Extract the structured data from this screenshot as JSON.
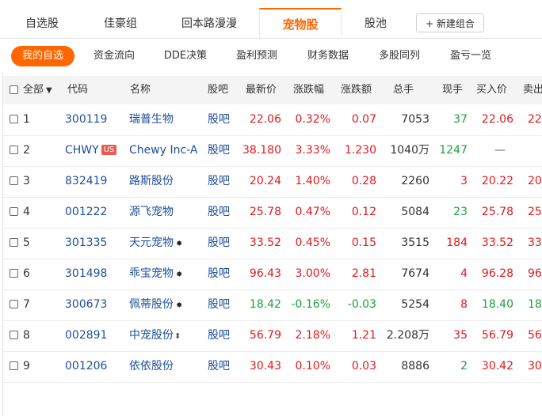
{
  "tabs": [
    {
      "label": "自选股"
    },
    {
      "label": "佳豪组"
    },
    {
      "label": "回本路漫漫"
    },
    {
      "label": "宠物股"
    },
    {
      "label": "股池"
    }
  ],
  "new_group_label": "+ 新建组合",
  "subnav": [
    {
      "label": "我的自选"
    },
    {
      "label": "资金流向"
    },
    {
      "label": "DDE决策"
    },
    {
      "label": "盈利预测"
    },
    {
      "label": "财务数据"
    },
    {
      "label": "多股同列"
    },
    {
      "label": "盈亏一览"
    }
  ],
  "table": {
    "headers": {
      "all": "全部",
      "code": "代码",
      "name": "名称",
      "bar": "股吧",
      "price": "最新价",
      "pct": "涨跌幅",
      "chg": "涨跌额",
      "vol": "总手",
      "cur": "现手",
      "bid": "买入价",
      "ask": "卖出"
    },
    "rows": [
      {
        "idx": "1",
        "code": "300119",
        "name": "瑞普生物",
        "badge": "",
        "mark": "",
        "bar": "股吧",
        "price": "22.06",
        "pct": "0.32%",
        "chg": "0.07",
        "vol": "7053",
        "cur": "37",
        "bid": "22.06",
        "ask": "22.",
        "pc": "red",
        "cc": "green"
      },
      {
        "idx": "2",
        "code": "CHWY",
        "name": "Chewy Inc-A",
        "badge": "US",
        "mark": "",
        "bar": "股吧",
        "price": "38.180",
        "pct": "3.33%",
        "chg": "1.230",
        "vol": "1040万",
        "cur": "1247",
        "bid": "—",
        "ask": "",
        "pc": "red",
        "cc": "green"
      },
      {
        "idx": "3",
        "code": "832419",
        "name": "路斯股份",
        "badge": "",
        "mark": "",
        "bar": "股吧",
        "price": "20.24",
        "pct": "1.40%",
        "chg": "0.28",
        "vol": "2260",
        "cur": "3",
        "bid": "20.22",
        "ask": "20.",
        "pc": "red",
        "cc": "red"
      },
      {
        "idx": "4",
        "code": "001222",
        "name": "源飞宠物",
        "badge": "",
        "mark": "",
        "bar": "股吧",
        "price": "25.78",
        "pct": "0.47%",
        "chg": "0.12",
        "vol": "5084",
        "cur": "23",
        "bid": "25.78",
        "ask": "25.",
        "pc": "red",
        "cc": "green"
      },
      {
        "idx": "5",
        "code": "301335",
        "name": "天元宠物",
        "badge": "",
        "mark": "✸",
        "bar": "股吧",
        "price": "33.52",
        "pct": "0.45%",
        "chg": "0.15",
        "vol": "3515",
        "cur": "184",
        "bid": "33.52",
        "ask": "33.",
        "pc": "red",
        "cc": "red"
      },
      {
        "idx": "6",
        "code": "301498",
        "name": "乖宝宠物",
        "badge": "",
        "mark": "✸",
        "bar": "股吧",
        "price": "96.43",
        "pct": "3.00%",
        "chg": "2.81",
        "vol": "7674",
        "cur": "4",
        "bid": "96.28",
        "ask": "96.",
        "pc": "red",
        "cc": "red"
      },
      {
        "idx": "7",
        "code": "300673",
        "name": "佩蒂股份",
        "badge": "",
        "mark": "✸",
        "bar": "股吧",
        "price": "18.42",
        "pct": "-0.16%",
        "chg": "-0.03",
        "vol": "5254",
        "cur": "8",
        "bid": "18.40",
        "ask": "18.",
        "pc": "green",
        "cc": "red"
      },
      {
        "idx": "8",
        "code": "002891",
        "name": "中宠股份",
        "badge": "",
        "mark": "⬍",
        "bar": "股吧",
        "price": "56.79",
        "pct": "2.18%",
        "chg": "1.21",
        "vol": "2.208万",
        "cur": "35",
        "bid": "56.79",
        "ask": "56.",
        "pc": "red",
        "cc": "red"
      },
      {
        "idx": "9",
        "code": "001206",
        "name": "依依股份",
        "badge": "",
        "mark": "",
        "bar": "股吧",
        "price": "30.43",
        "pct": "0.10%",
        "chg": "0.03",
        "vol": "8886",
        "cur": "2",
        "bid": "30.42",
        "ask": "30.",
        "pc": "red",
        "cc": "green"
      }
    ]
  }
}
